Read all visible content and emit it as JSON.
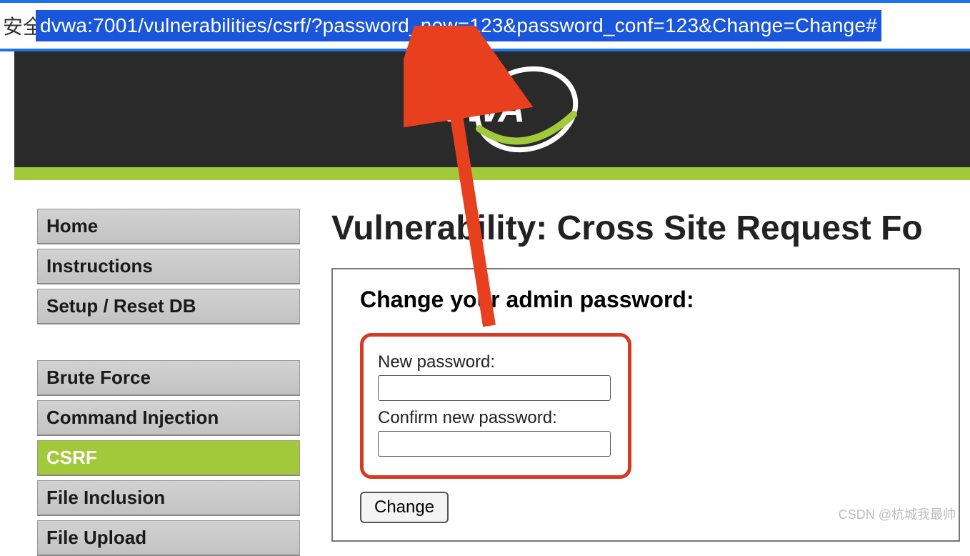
{
  "url_bar": {
    "security_prefix": "安全",
    "url": "dvwa:7001/vulnerabilities/csrf/?password_new=123&password_conf=123&Change=Change#"
  },
  "logo_text": "DVWA",
  "sidebar": {
    "group1": [
      {
        "label": "Home"
      },
      {
        "label": "Instructions"
      },
      {
        "label": "Setup / Reset DB"
      }
    ],
    "group2": [
      {
        "label": "Brute Force"
      },
      {
        "label": "Command Injection"
      },
      {
        "label": "CSRF",
        "active": true
      },
      {
        "label": "File Inclusion"
      },
      {
        "label": "File Upload"
      }
    ]
  },
  "main": {
    "title": "Vulnerability: Cross Site Request Fo",
    "panel_heading": "Change your admin password:",
    "label_new": "New password:",
    "label_confirm": "Confirm new password:",
    "button_label": "Change"
  },
  "watermark": "CSDN @杭城我最帅"
}
